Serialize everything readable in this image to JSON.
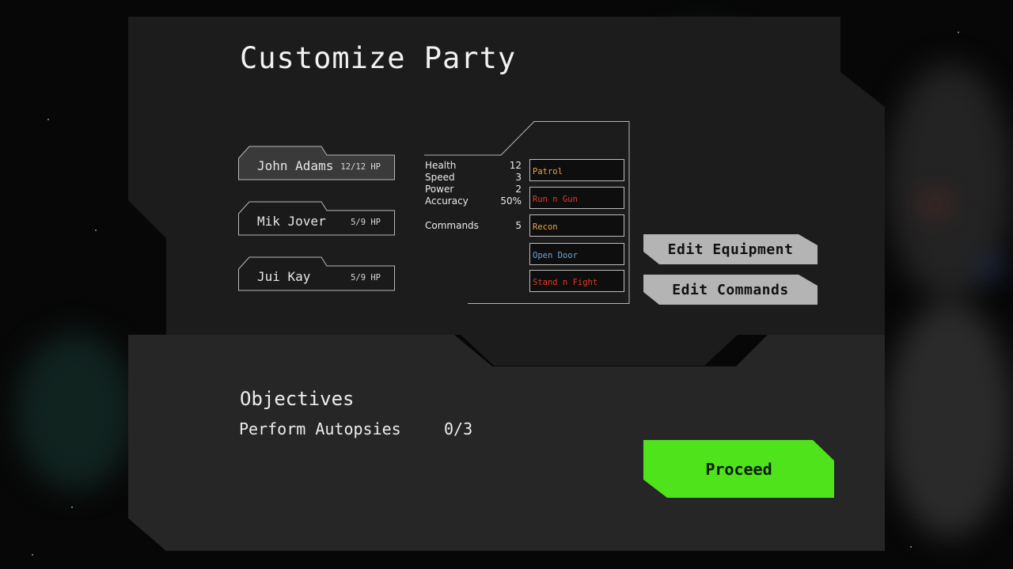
{
  "title": "Customize Party",
  "members": [
    {
      "name": "John Adams",
      "hp": "12/12 HP",
      "selected": true
    },
    {
      "name": "Mik Jover",
      "hp": "5/9 HP",
      "selected": false
    },
    {
      "name": "Jui Kay",
      "hp": "5/9 HP",
      "selected": false
    }
  ],
  "stats": [
    {
      "label": "Health",
      "value": "12"
    },
    {
      "label": "Speed",
      "value": "3"
    },
    {
      "label": "Power",
      "value": "2"
    },
    {
      "label": "Accuracy",
      "value": "50%"
    },
    {
      "label": "Commands",
      "value": "5"
    }
  ],
  "commands": [
    {
      "label": "Patrol",
      "color": "#e6a64a"
    },
    {
      "label": "Run n Gun",
      "color": "#e23a2a"
    },
    {
      "label": "Recon",
      "color": "#e6a64a"
    },
    {
      "label": "Open Door",
      "color": "#6fa6d8"
    },
    {
      "label": "Stand n Fight",
      "color": "#e23a2a"
    }
  ],
  "buttons": {
    "edit_equipment": "Edit Equipment",
    "edit_commands": "Edit Commands",
    "proceed": "Proceed"
  },
  "objectives": {
    "title": "Objectives",
    "items": [
      {
        "name": "Perform Autopsies",
        "progress": "0/3"
      }
    ]
  },
  "colors": {
    "proceed": "#4fe31c",
    "button": "#b4b4b4",
    "panel_top": "#1c1c1c",
    "panel_bottom": "#262626"
  }
}
